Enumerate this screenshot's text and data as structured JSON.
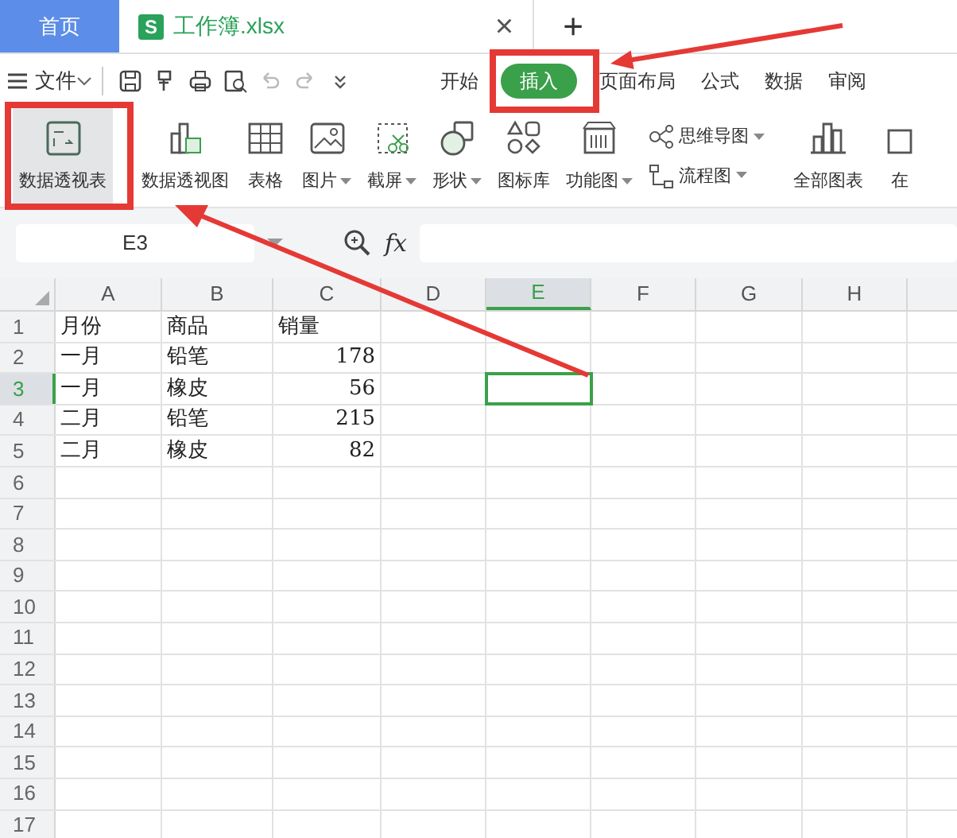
{
  "tabs": [
    {
      "label": "首页",
      "kind": "home",
      "selected": false
    },
    {
      "label": "工作簿.xlsx",
      "kind": "file",
      "selected": true,
      "badge": "S",
      "close": "×"
    }
  ],
  "new_tab": "+",
  "menu": {
    "file": "文件",
    "tabs": [
      {
        "label": "开始",
        "selected": false
      },
      {
        "label": "插入",
        "selected": true
      },
      {
        "label": "页面布局",
        "selected": false
      },
      {
        "label": "公式",
        "selected": false
      },
      {
        "label": "数据",
        "selected": false
      },
      {
        "label": "审阅",
        "selected": false
      }
    ]
  },
  "ribbon": [
    {
      "kind": "large",
      "label": "数据透视表",
      "dropdown": false,
      "selected": true
    },
    {
      "kind": "large",
      "label": "数据透视图",
      "dropdown": false,
      "selected": false
    },
    {
      "kind": "large",
      "label": "表格",
      "dropdown": false,
      "selected": false
    },
    {
      "kind": "large",
      "label": "图片",
      "dropdown": true,
      "selected": false
    },
    {
      "kind": "large",
      "label": "截屏",
      "dropdown": true,
      "selected": false
    },
    {
      "kind": "large",
      "label": "形状",
      "dropdown": true,
      "selected": false
    },
    {
      "kind": "large",
      "label": "图标库",
      "dropdown": false,
      "selected": false
    },
    {
      "kind": "large",
      "label": "功能图",
      "dropdown": true,
      "selected": false
    },
    {
      "kind": "stack",
      "items": [
        {
          "label": "思维导图",
          "dropdown": true
        },
        {
          "label": "流程图",
          "dropdown": true
        }
      ]
    },
    {
      "kind": "large",
      "label": "全部图表",
      "dropdown": false,
      "selected": false
    },
    {
      "kind": "large",
      "label": "在",
      "dropdown": false,
      "selected": false
    }
  ],
  "formula_bar": {
    "cell_ref": "E3",
    "fx": "fx"
  },
  "sheet": {
    "columns": [
      {
        "label": "A",
        "selected": false
      },
      {
        "label": "B",
        "selected": false
      },
      {
        "label": "C",
        "selected": false
      },
      {
        "label": "D",
        "selected": false
      },
      {
        "label": "E",
        "selected": true
      },
      {
        "label": "F",
        "selected": false
      },
      {
        "label": "G",
        "selected": false
      },
      {
        "label": "H",
        "selected": false
      }
    ],
    "rows": [
      {
        "header": "1",
        "selected": false,
        "cells": [
          {
            "text": "月份",
            "kind": "text"
          },
          {
            "text": "商品",
            "kind": "text"
          },
          {
            "text": "销量",
            "kind": "text"
          }
        ]
      },
      {
        "header": "2",
        "selected": false,
        "cells": [
          {
            "text": "一月",
            "kind": "text"
          },
          {
            "text": "铅笔",
            "kind": "text"
          },
          {
            "text": "178",
            "kind": "number"
          }
        ]
      },
      {
        "header": "3",
        "selected": true,
        "cells": [
          {
            "text": "一月",
            "kind": "text"
          },
          {
            "text": "橡皮",
            "kind": "text"
          },
          {
            "text": "56",
            "kind": "number"
          }
        ]
      },
      {
        "header": "4",
        "selected": false,
        "cells": [
          {
            "text": "二月",
            "kind": "text"
          },
          {
            "text": "铅笔",
            "kind": "text"
          },
          {
            "text": "215",
            "kind": "number"
          }
        ]
      },
      {
        "header": "5",
        "selected": false,
        "cells": [
          {
            "text": "二月",
            "kind": "text"
          },
          {
            "text": "橡皮",
            "kind": "text"
          },
          {
            "text": "82",
            "kind": "number"
          }
        ]
      },
      {
        "header": "6",
        "selected": false,
        "cells": []
      },
      {
        "header": "7",
        "selected": false,
        "cells": []
      },
      {
        "header": "8",
        "selected": false,
        "cells": []
      },
      {
        "header": "9",
        "selected": false,
        "cells": []
      },
      {
        "header": "10",
        "selected": false,
        "cells": []
      },
      {
        "header": "11",
        "selected": false,
        "cells": []
      },
      {
        "header": "12",
        "selected": false,
        "cells": []
      },
      {
        "header": "13",
        "selected": false,
        "cells": []
      },
      {
        "header": "14",
        "selected": false,
        "cells": []
      },
      {
        "header": "15",
        "selected": false,
        "cells": []
      },
      {
        "header": "16",
        "selected": false,
        "cells": []
      },
      {
        "header": "17",
        "selected": false,
        "cells": []
      }
    ]
  }
}
